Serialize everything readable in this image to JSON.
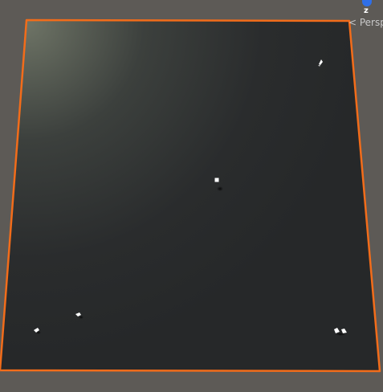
{
  "scene_view": {
    "gizmo": {
      "axis_label": "z",
      "projection_label": "< Persp"
    },
    "colors": {
      "background": "#5d5a56",
      "plane_dark": "#262829",
      "plane_light": "#6e7466",
      "selection_outline": "#f26c1a",
      "gizmo_z_axis": "#2f6fe8"
    },
    "icons": [
      "move-gizmo-icon",
      "small-object-icon",
      "player-object-icon"
    ]
  }
}
